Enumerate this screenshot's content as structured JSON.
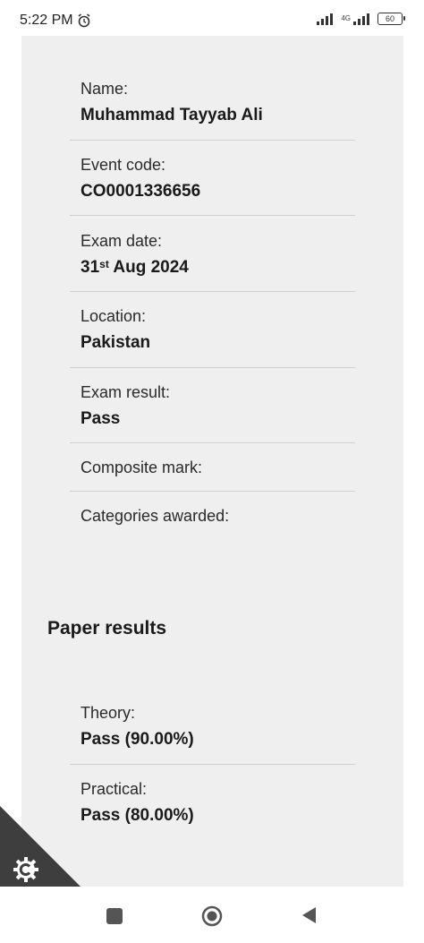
{
  "status_bar": {
    "time": "5:22 PM",
    "network": "4G",
    "battery": "60"
  },
  "fields": [
    {
      "label": "Name:",
      "value": "Muhammad Tayyab Ali"
    },
    {
      "label": "Event code:",
      "value": "CO0001336656"
    },
    {
      "label": "Exam date:",
      "value_day": "31",
      "value_suffix": "st",
      "value_rest": " Aug 2024"
    },
    {
      "label": "Location:",
      "value": "Pakistan"
    },
    {
      "label": "Exam result:",
      "value": "Pass"
    },
    {
      "label": "Composite mark:"
    },
    {
      "label": "Categories awarded:"
    }
  ],
  "paper_results": {
    "title": "Paper results",
    "items": [
      {
        "label": "Theory:",
        "value": "Pass (90.00%)"
      },
      {
        "label": "Practical:",
        "value": "Pass (80.00%)"
      }
    ]
  },
  "icons": {
    "alarm": "alarm-clock-icon",
    "settings": "gear-icon",
    "nav_recent": "square-icon",
    "nav_home": "circle-icon",
    "nav_back": "triangle-back-icon"
  }
}
